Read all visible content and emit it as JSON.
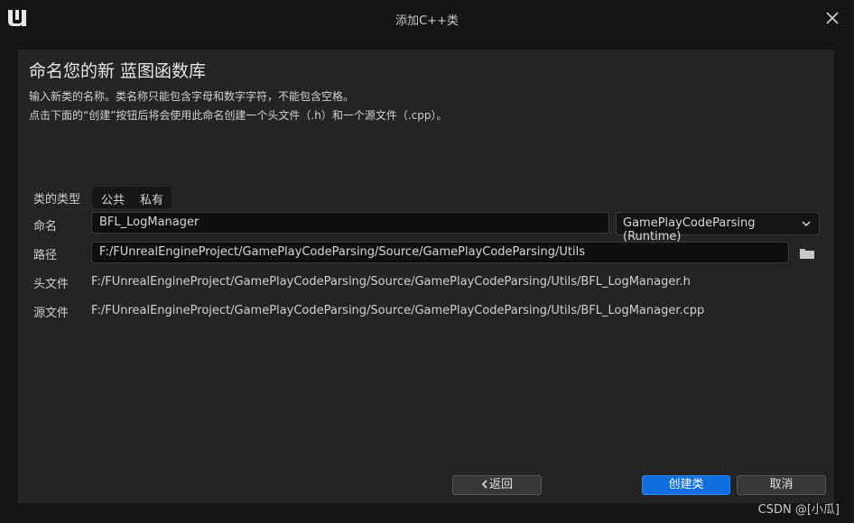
{
  "window": {
    "title": "添加C++类",
    "logo_icon": "unreal-engine-logo",
    "close_icon": "close-icon"
  },
  "main": {
    "heading": "命名您的新 蓝图函数库",
    "desc_line1": "输入新类的名称。类名称只能包含字母和数字字符，不能包含空格。",
    "desc_line2": "点击下面的“创建”按钮后将会使用此命名创建一个头文件（.h）和一个源文件（.cpp）。"
  },
  "form": {
    "class_type_label": "类的类型",
    "class_type_public": "公共",
    "class_type_private": "私有",
    "name_label": "命名",
    "name_value": "BFL_LogManager",
    "module_value": "GamePlayCodeParsing (Runtime)",
    "path_label": "路径",
    "path_value": "F:/FUnrealEngineProject/GamePlayCodeParsing/Source/GamePlayCodeParsing/Utils",
    "header_label": "头文件",
    "header_value": "F:/FUnrealEngineProject/GamePlayCodeParsing/Source/GamePlayCodeParsing/Utils/BFL_LogManager.h",
    "source_label": "源文件",
    "source_value": "F:/FUnrealEngineProject/GamePlayCodeParsing/Source/GamePlayCodeParsing/Utils/BFL_LogManager.cpp"
  },
  "buttons": {
    "back": "返回",
    "create": "创建类",
    "cancel": "取消"
  },
  "watermark": "CSDN @[小瓜]",
  "colors": {
    "accent": "#0F6FE0",
    "panel": "#242424",
    "background": "#151515"
  }
}
